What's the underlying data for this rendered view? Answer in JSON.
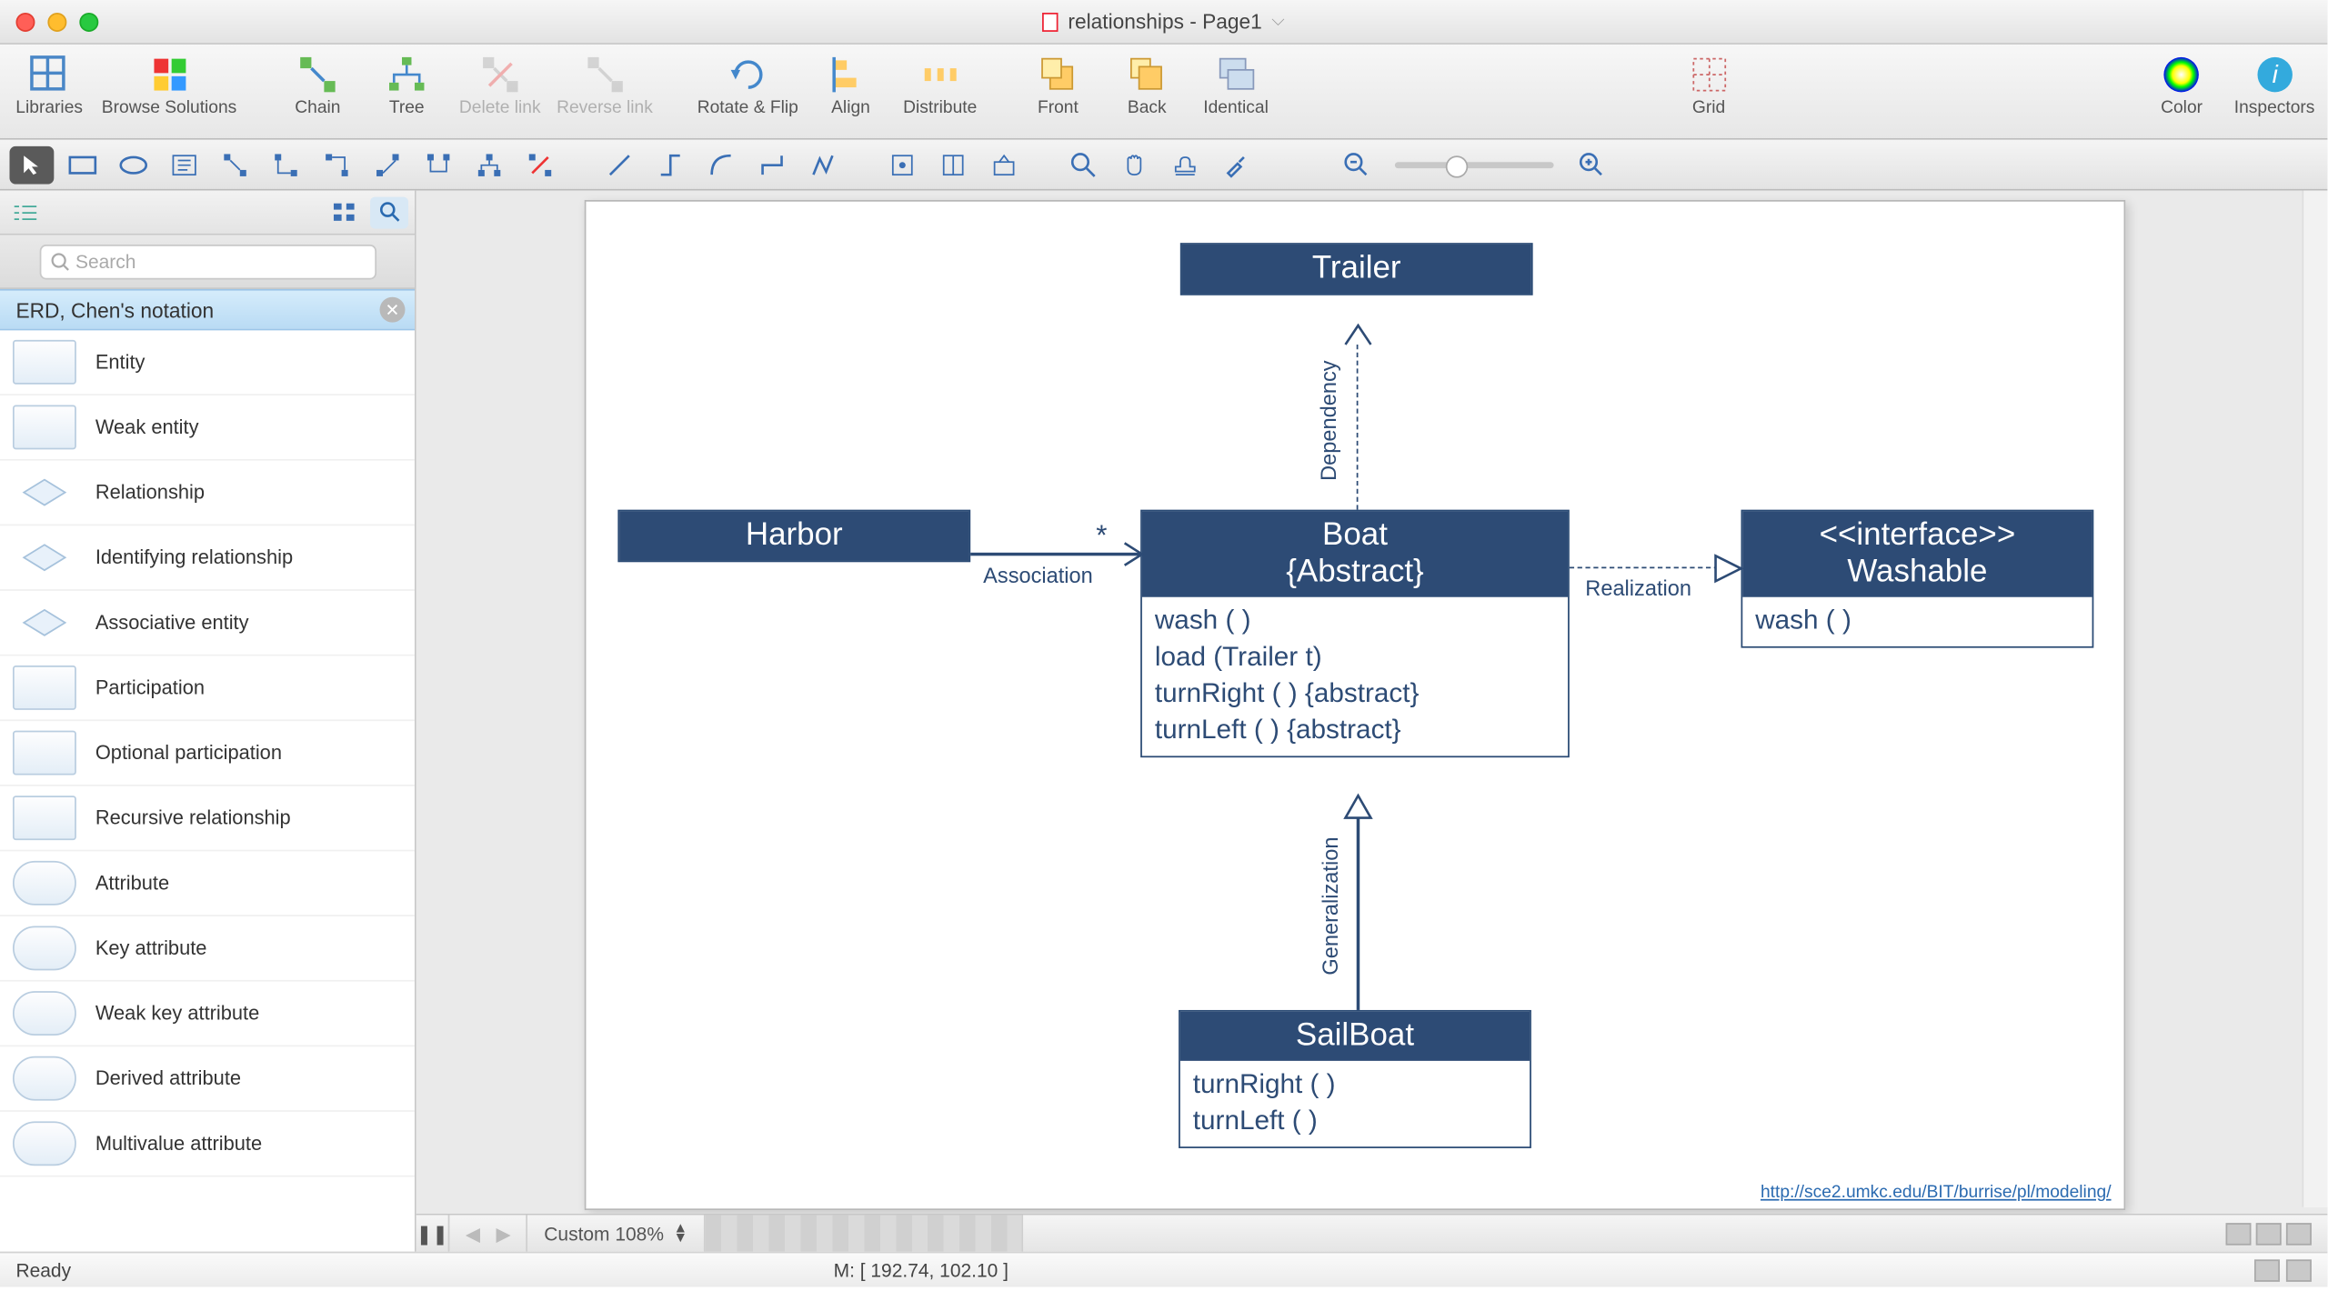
{
  "window": {
    "title": "relationships - Page1"
  },
  "toolbar": {
    "libraries": "Libraries",
    "browse": "Browse Solutions",
    "chain": "Chain",
    "tree": "Tree",
    "delete_link": "Delete link",
    "reverse_link": "Reverse link",
    "rotate_flip": "Rotate & Flip",
    "align": "Align",
    "distribute": "Distribute",
    "front": "Front",
    "back": "Back",
    "identical": "Identical",
    "grid": "Grid",
    "color": "Color",
    "inspectors": "Inspectors"
  },
  "sidebar": {
    "search_placeholder": "Search",
    "category": "ERD, Chen's notation",
    "items": [
      "Entity",
      "Weak entity",
      "Relationship",
      "Identifying relationship",
      "Associative entity",
      "Participation",
      "Optional participation",
      "Recursive relationship",
      "Attribute",
      "Key attribute",
      "Weak key attribute",
      "Derived attribute",
      "Multivalue attribute"
    ]
  },
  "diagram": {
    "trailer": "Trailer",
    "harbor": "Harbor",
    "boat_title1": "Boat",
    "boat_title2": "{Abstract}",
    "boat_ops": [
      "wash ( )",
      "load (Trailer t)",
      "turnRight ( ) {abstract}",
      "turnLeft ( ) {abstract}"
    ],
    "interface1": "<<interface>>",
    "interface2": "Washable",
    "interface_ops": [
      "wash ( )"
    ],
    "sailboat": "SailBoat",
    "sailboat_ops": [
      "turnRight ( )",
      "turnLeft ( )"
    ],
    "lbl_dependency": "Dependency",
    "lbl_association": "Association",
    "lbl_realization": "Realization",
    "lbl_generalization": "Generalization",
    "lbl_star": "*",
    "footer_url": "http://sce2.umkc.edu/BIT/burrise/pl/modeling/"
  },
  "status": {
    "zoom_label": "Custom 108%",
    "ready": "Ready",
    "mouse": "M: [ 192.74, 102.10 ]"
  },
  "chart_data": {
    "type": "uml_diagram",
    "classes": [
      {
        "name": "Trailer",
        "stereotype": null,
        "operations": []
      },
      {
        "name": "Harbor",
        "stereotype": null,
        "operations": []
      },
      {
        "name": "Boat",
        "stereotype": "{Abstract}",
        "operations": [
          "wash()",
          "load(Trailer t)",
          "turnRight() {abstract}",
          "turnLeft() {abstract}"
        ]
      },
      {
        "name": "Washable",
        "stereotype": "<<interface>>",
        "operations": [
          "wash()"
        ]
      },
      {
        "name": "SailBoat",
        "stereotype": null,
        "operations": [
          "turnRight()",
          "turnLeft()"
        ]
      }
    ],
    "relationships": [
      {
        "from": "Harbor",
        "to": "Boat",
        "type": "Association",
        "multiplicity_to": "*"
      },
      {
        "from": "Boat",
        "to": "Trailer",
        "type": "Dependency"
      },
      {
        "from": "Boat",
        "to": "Washable",
        "type": "Realization"
      },
      {
        "from": "SailBoat",
        "to": "Boat",
        "type": "Generalization"
      }
    ]
  }
}
